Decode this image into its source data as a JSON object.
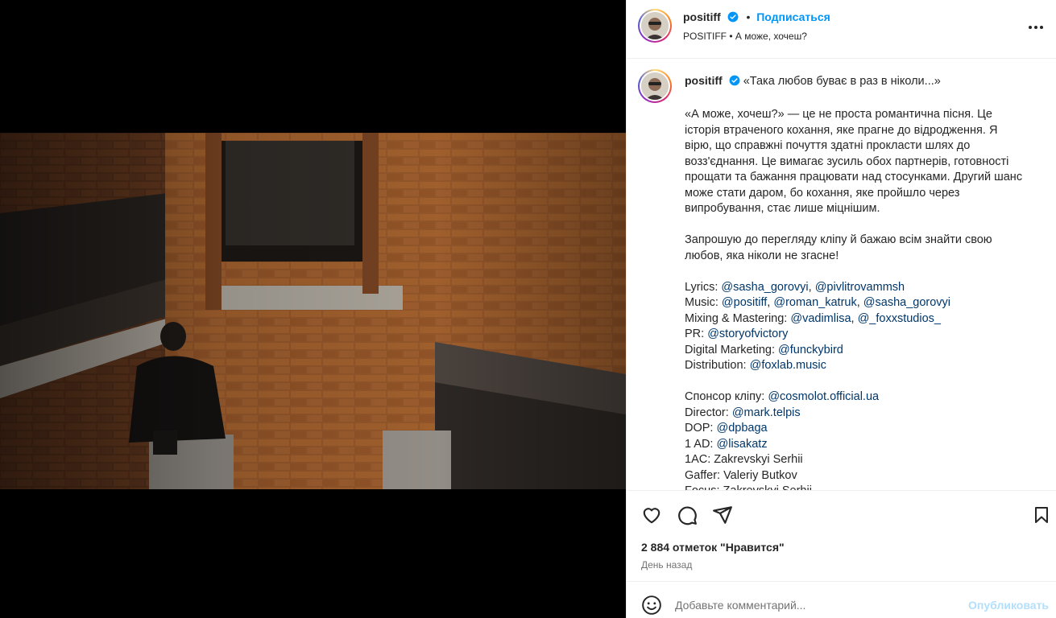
{
  "header": {
    "username": "positiff",
    "dot": "•",
    "follow_label": "Подписаться",
    "subtitle": "POSITIFF • А може, хочеш?",
    "more_icon": "more-horizontal-icon"
  },
  "caption": {
    "username": "positiff",
    "headline": "«Така любов буває в раз в ніколи...»",
    "paragraph1": "«А може, хочеш?» — це не проста романтична пісня. Це історія втраченого кохання, яке прагне до відродження. Я вірю, що справжні почуття здатні прокласти шлях до возз'єднання. Це вимагає зусиль обох партнерів, готовності прощати та бажання працювати над стосунками. Другий шанс може стати даром, бо кохання, яке пройшло через випробування, стає лише міцнішим.",
    "paragraph2": "Запрошую до перегляду кліпу й бажаю всім знайти свою любов, яка ніколи не згасне!",
    "credits": {
      "lyrics_label": "Lyrics: ",
      "lyrics_m1": "@sasha_gorovyi",
      "lyrics_m2": "@pivlitrovammsh",
      "music_label": "Music: ",
      "music_m1": "@positiff",
      "music_m2": "@roman_katruk",
      "music_m3": "@sasha_gorovyi",
      "mixing_label": "Mixing & Mastering: ",
      "mixing_m1": "@vadimlisa",
      "mixing_m2": "@_foxxstudios_",
      "pr_label": "PR: ",
      "pr_m1": "@storyofvictory",
      "dm_label": "Digital Marketing: ",
      "dm_m1": "@funckybird",
      "dist_label": "Distribution: ",
      "dist_m1": "@foxlab.music",
      "sponsor_label": "Спонсор кліпу: ",
      "sponsor_m1": "@cosmolot.official.ua",
      "director_label": "Director: ",
      "director_m1": "@mark.telpis",
      "dop_label": "DOP: ",
      "dop_m1": "@dpbaga",
      "ad_label": "1 AD: ",
      "ad_m1": "@lisakatz",
      "ac_line": "1AC: Zakrevskyi Serhii",
      "gaffer_line": "Gaffer: Valeriy Butkov",
      "focus_line": "Focus: Zakrevskyi Serhii",
      "comma": ", "
    }
  },
  "actions": {
    "like_icon": "heart-icon",
    "comment_icon": "comment-icon",
    "share_icon": "share-icon",
    "save_icon": "bookmark-icon"
  },
  "likes_text": "2 884 отметок \"Нравится\"",
  "time_text": "День назад",
  "comment": {
    "placeholder": "Добавьте комментарий...",
    "publish_label": "Опубликовать",
    "emoji_icon": "emoji-icon"
  },
  "video": {
    "mute_icon": "muted-speaker-icon"
  },
  "colors": {
    "link": "#00376b",
    "follow": "#0095f6",
    "verified": "#0095f6",
    "publish_disabled": "#b2dffc"
  }
}
